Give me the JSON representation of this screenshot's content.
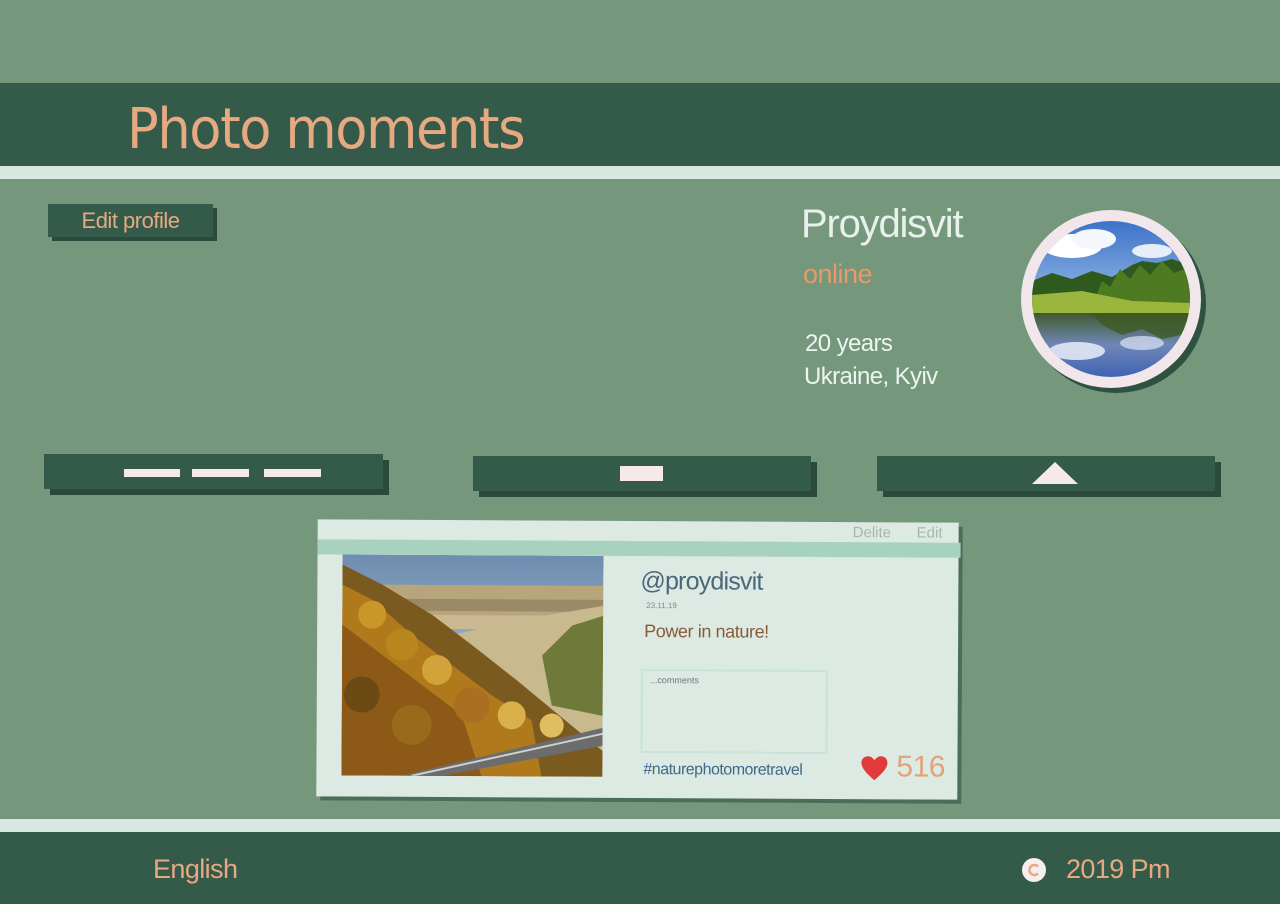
{
  "header": {
    "title": "Photo moments"
  },
  "profile": {
    "edit_label": "Edit profile",
    "name": "Proydisvit",
    "status": "online",
    "age": "20 years",
    "location": "Ukraine, Kyiv",
    "avatar_icon": "landscape-avatar"
  },
  "nav": {
    "buttons": [
      {
        "icon": "three-dashes-icon"
      },
      {
        "icon": "square-icon"
      },
      {
        "icon": "triangle-up-icon"
      }
    ]
  },
  "post": {
    "delete_label": "Delite",
    "edit_label": "Edit",
    "handle": "@proydisvit",
    "date": "23.11.19",
    "caption": "Power in nature!",
    "comment_placeholder": "...comments",
    "hashtag": "#naturephotomoretravel",
    "likes": "516"
  },
  "footer": {
    "language": "English",
    "copyright": "2019 Pm"
  },
  "colors": {
    "background": "#75977c",
    "header": "#345a49",
    "accent": "#e6a982",
    "like": "#e03a3a"
  }
}
